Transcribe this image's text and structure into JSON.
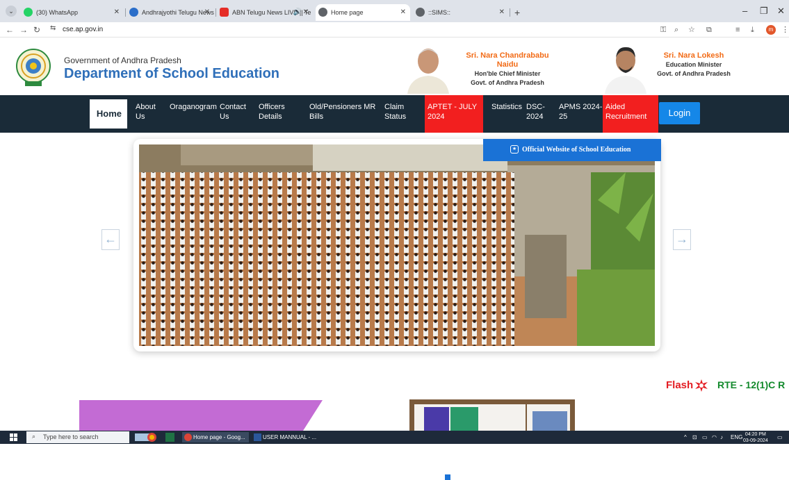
{
  "browser": {
    "tabs": [
      {
        "title": "(30) WhatsApp",
        "color": "#25d366"
      },
      {
        "title": "Andhrajyothi Telugu News: Late",
        "color": "#2b6ec9"
      },
      {
        "title": "ABN Telugu News LIVE || Te",
        "color": "#e52d27"
      },
      {
        "title": "Home page",
        "color": "#5f6368"
      },
      {
        "title": "::SIMS::",
        "color": "#5f6368"
      }
    ],
    "url": "cse.ap.gov.in",
    "profile_initial": "m"
  },
  "header": {
    "gov_line": "Government of Andhra Pradesh",
    "dept_title": "Department of School Education",
    "persons": [
      {
        "name": "Sri. Nara Chandrababu Naidu",
        "role": "Hon'ble Chief Minister",
        "org": "Govt. of Andhra Pradesh"
      },
      {
        "name": "Sri. Nara Lokesh",
        "role": "Education Minister",
        "org": "Govt. of Andhra Pradesh"
      }
    ]
  },
  "nav": {
    "home": "Home",
    "about": [
      "About",
      "Us"
    ],
    "organogram": "Oraganogram",
    "contact": [
      "Contact",
      "Us"
    ],
    "officers": [
      "Officers",
      "Details"
    ],
    "pensioners": [
      "Old/Pensioners MR",
      "Bills"
    ],
    "claim": [
      "Claim",
      "Status"
    ],
    "aptet": [
      "APTET - JULY",
      "2024"
    ],
    "statistics": "Statistics",
    "dsc": [
      "DSC-",
      "2024"
    ],
    "apms": [
      "APMS 2024-",
      "25"
    ],
    "aided": [
      "Aided",
      "Recruitment"
    ],
    "login": "Login",
    "accent_red": "#f21f1f",
    "accent_blue": "#1587e8"
  },
  "carousel": {
    "badge": "Official Website of School Education",
    "prev": "←",
    "next": "→"
  },
  "flash": {
    "label": "Flash",
    "text": "RTE - 12(1)C R"
  },
  "taskbar": {
    "search_placeholder": "Type here to search",
    "apps": [
      "Home page - Goog...",
      "USER MANNUAL - ..."
    ],
    "lang": "ENG",
    "time": "04:20 PM",
    "date": "03-09-2024"
  }
}
